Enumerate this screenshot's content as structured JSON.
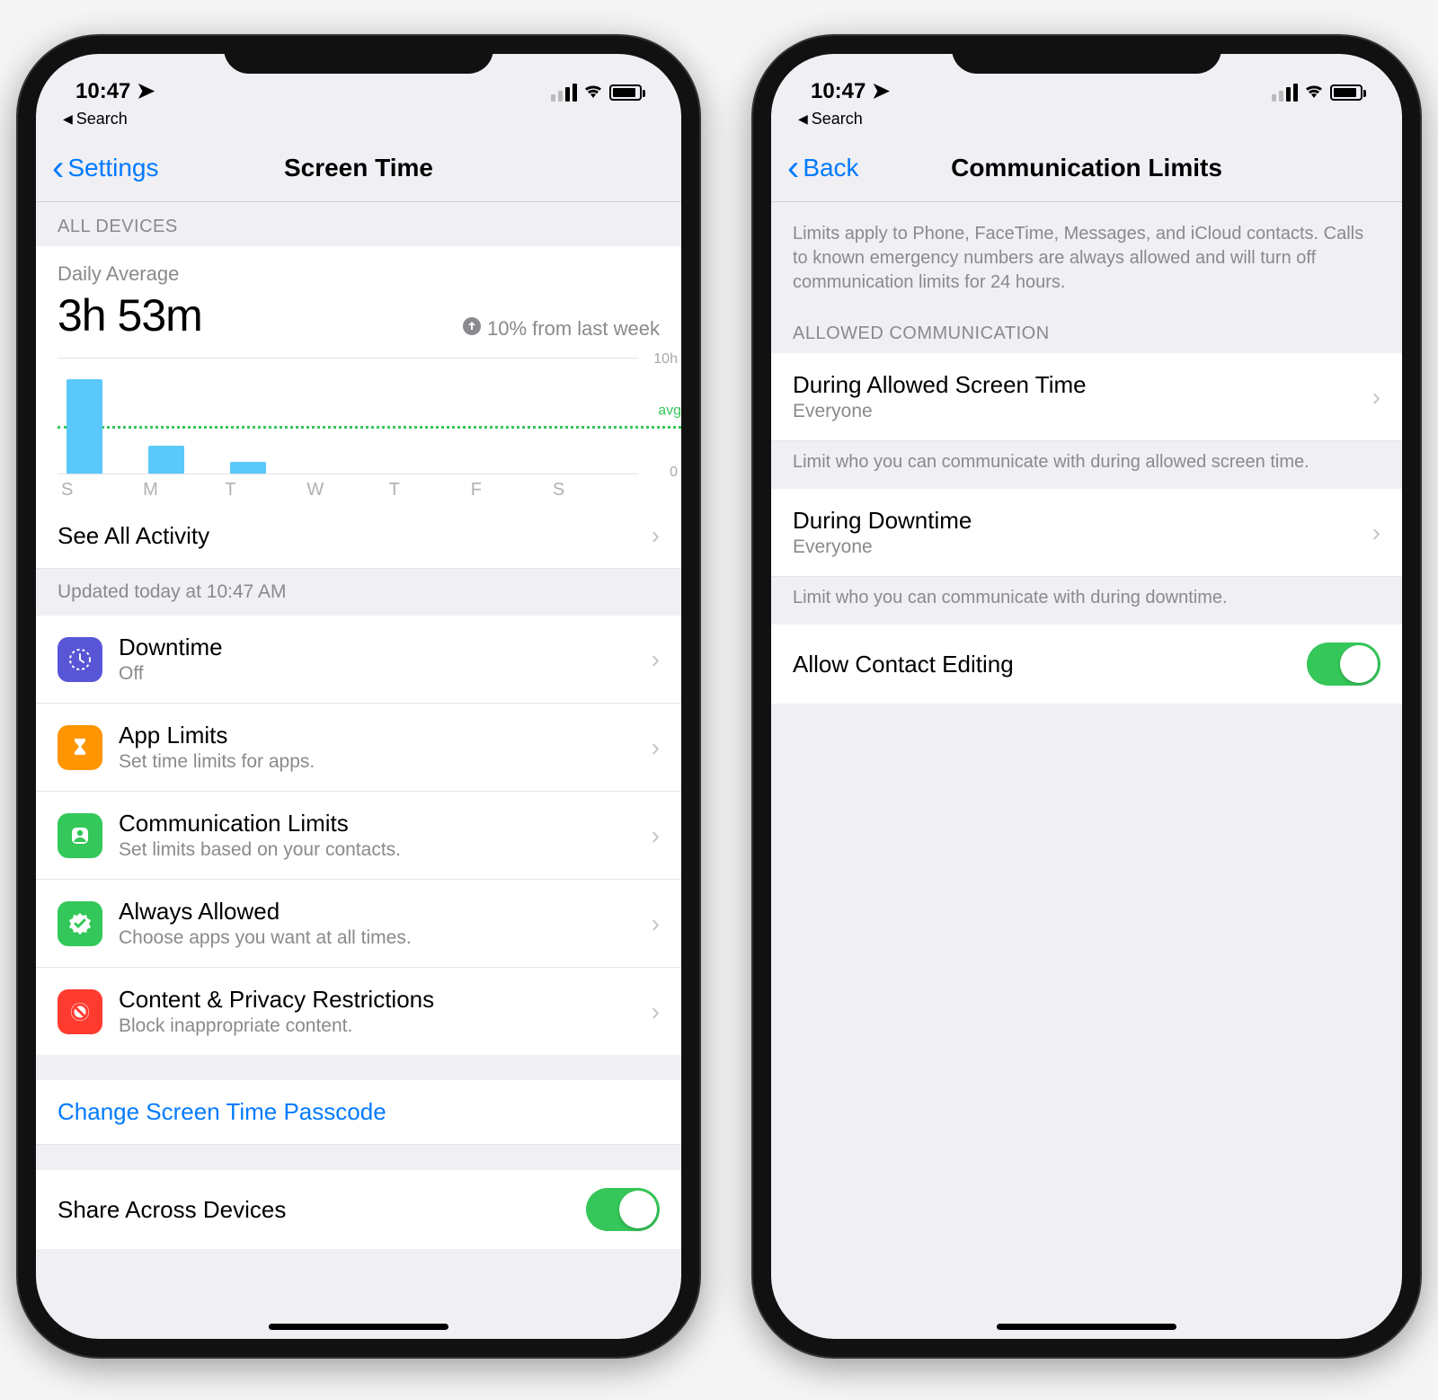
{
  "status": {
    "time": "10:47",
    "breadcrumb": "Search"
  },
  "left": {
    "nav_back": "Settings",
    "nav_title": "Screen Time",
    "section_all_devices": "ALL DEVICES",
    "daily_label": "Daily Average",
    "daily_value": "3h 53m",
    "delta_text": "10% from last week",
    "y_top": "10h",
    "y_bottom": "0",
    "avg_label": "avg",
    "see_all": "See All Activity",
    "updated": "Updated today at 10:47 AM",
    "rows": {
      "downtime_t": "Downtime",
      "downtime_s": "Off",
      "applimits_t": "App Limits",
      "applimits_s": "Set time limits for apps.",
      "comm_t": "Communication Limits",
      "comm_s": "Set limits based on your contacts.",
      "always_t": "Always Allowed",
      "always_s": "Choose apps you want at all times.",
      "content_t": "Content & Privacy Restrictions",
      "content_s": "Block inappropriate content."
    },
    "passcode": "Change Screen Time Passcode",
    "share": "Share Across Devices"
  },
  "right": {
    "nav_back": "Back",
    "nav_title": "Communication Limits",
    "intro": "Limits apply to Phone, FaceTime, Messages, and iCloud contacts. Calls to known emergency numbers are always allowed and will turn off communication limits for 24 hours.",
    "section": "ALLOWED COMMUNICATION",
    "allowed_t": "During Allowed Screen Time",
    "allowed_s": "Everyone",
    "allowed_foot": "Limit who you can communicate with during allowed screen time.",
    "down_t": "During Downtime",
    "down_s": "Everyone",
    "down_foot": "Limit who you can communicate with during downtime.",
    "edit_t": "Allow Contact Editing"
  },
  "chart_data": {
    "type": "bar",
    "title": "Daily Average 3h 53m",
    "categories": [
      "S",
      "M",
      "T",
      "W",
      "T",
      "F",
      "S"
    ],
    "values": [
      8.2,
      2.4,
      1.0,
      0,
      0,
      0,
      0
    ],
    "ylabel": "hours",
    "ylim": [
      0,
      10
    ],
    "average": 3.88,
    "delta_from_last_week_pct": 10
  }
}
